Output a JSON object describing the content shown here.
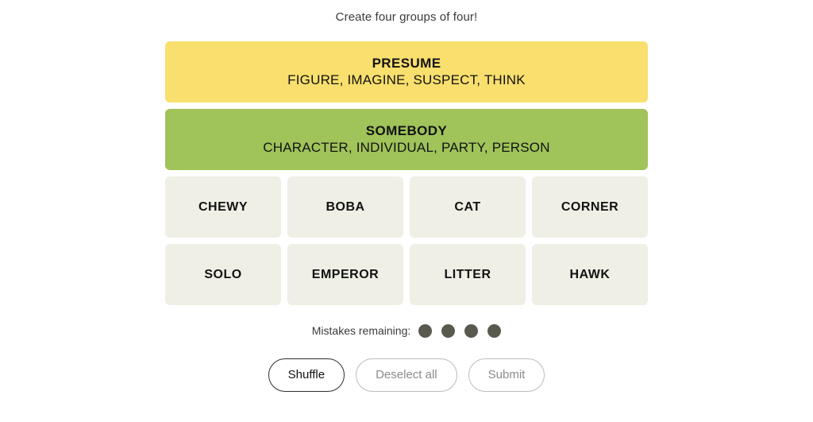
{
  "instruction": "Create four groups of four!",
  "solved_groups": [
    {
      "title": "PRESUME",
      "members": "FIGURE, IMAGINE, SUSPECT, THINK",
      "color": "#f9df6d"
    },
    {
      "title": "SOMEBODY",
      "members": "CHARACTER, INDIVIDUAL, PARTY, PERSON",
      "color": "#a0c35a"
    }
  ],
  "tiles": [
    [
      {
        "label": "CHEWY"
      },
      {
        "label": "BOBA"
      },
      {
        "label": "CAT"
      },
      {
        "label": "CORNER"
      }
    ],
    [
      {
        "label": "SOLO"
      },
      {
        "label": "EMPEROR"
      },
      {
        "label": "LITTER"
      },
      {
        "label": "HAWK"
      }
    ]
  ],
  "mistakes": {
    "label": "Mistakes remaining:",
    "remaining": 4,
    "dot_color": "#5a594e"
  },
  "actions": [
    {
      "label": "Shuffle",
      "state": "active"
    },
    {
      "label": "Deselect all",
      "state": "disabled"
    },
    {
      "label": "Submit",
      "state": "disabled"
    }
  ]
}
